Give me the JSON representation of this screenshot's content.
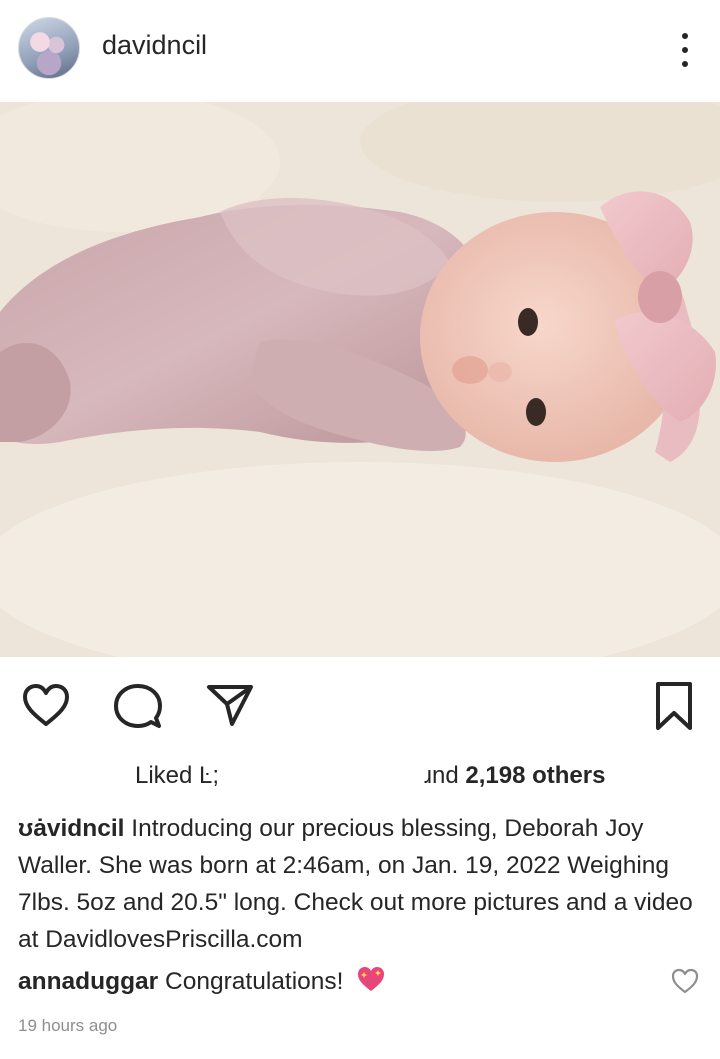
{
  "post": {
    "username": "davidncil"
  },
  "actions": {
    "like_icon": "heart-icon",
    "comment_icon": "comment-icon",
    "share_icon": "send-icon",
    "save_icon": "bookmark-icon"
  },
  "likes": {
    "prefix": "Liked Ŀ;",
    "suffix": "ɹnd",
    "count_text": "2,198 others"
  },
  "caption": {
    "username": "ʊȧvidncil",
    "text": "Introducing our precious blessing, Deborah Joy Waller. She was born at 2:46am, on Jan. 19, 2022 Weighing 7lbs. 5oz and 20.5\" long. Check out more pictures and a video at DavidlovesPriscilla.com"
  },
  "comment": {
    "username": "annaduggar",
    "text": "Congratulations!",
    "emoji": "sparkling-heart-icon"
  },
  "timestamp": "19 hours ago",
  "colors": {
    "text": "#262626",
    "muted": "#8e8e8e",
    "background": "#ffffff"
  }
}
